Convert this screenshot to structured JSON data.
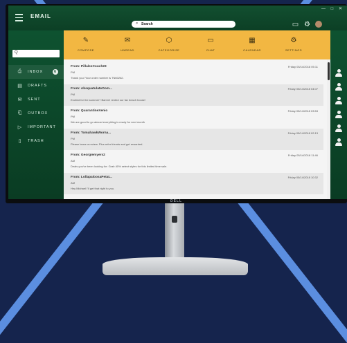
{
  "app": {
    "title": "EMAIL",
    "window_controls": "— □ ✕"
  },
  "search": {
    "text": "Search",
    "sidebar_placeholder": "Q"
  },
  "monitor": {
    "brand": "DELL"
  },
  "nav": [
    {
      "label": "INBOX",
      "icon": "inbox-icon",
      "glyph": "⎙",
      "badge": "6",
      "active": true
    },
    {
      "label": "DRAFTS",
      "icon": "drafts-icon",
      "glyph": "▤"
    },
    {
      "label": "SENT",
      "icon": "sent-icon",
      "glyph": "✉"
    },
    {
      "label": "OUTBOX",
      "icon": "outbox-icon",
      "glyph": "⎗"
    },
    {
      "label": "IMPORTANT",
      "icon": "important-icon",
      "glyph": "▷"
    },
    {
      "label": "TRASH",
      "icon": "trash-icon",
      "glyph": "▯"
    }
  ],
  "toolbar": [
    {
      "label": "COMPOSE",
      "icon": "pencil-icon",
      "glyph": "✎"
    },
    {
      "label": "UNREAD",
      "icon": "envelope-icon",
      "glyph": "✉"
    },
    {
      "label": "CATEGORIZE",
      "icon": "tag-icon",
      "glyph": "⬡"
    },
    {
      "label": "CHAT",
      "icon": "chat-icon",
      "glyph": "▭"
    },
    {
      "label": "CALENDAR",
      "icon": "calendar-icon",
      "glyph": "▦"
    },
    {
      "label": "SETTINGS",
      "icon": "gear-icon",
      "glyph": "⚙"
    }
  ],
  "messages": [
    {
      "from": "From: PillaleeCouch23",
      "date": "Friday 05/14/2018 05:11",
      "pm": "PM",
      "preview": "Thank you! Your order number is TN60262."
    },
    {
      "from": "From: AbsquatulateOom...",
      "date": "Friday 05/14/2018 04:07",
      "pm": "PM",
      "preview": "Excited for the summer? Bamm! rented our fav beach house!"
    },
    {
      "from": "From: QuarantineXenio",
      "date": "Friday 05/14/2018 03:53",
      "pm": "PM",
      "preview": "We are good to go almost everything is ready for next month"
    },
    {
      "from": "From: TomahawkWorna...",
      "date": "Friday 05/14/2018 02:13",
      "pm": "PM",
      "preview": "Please leave a review. Plus refer friends and get rewarded."
    },
    {
      "from": "From: Georgiemyers2",
      "date": "Friday 05/14/2018 11:46",
      "pm": "AM",
      "preview": "Deals you've been looking for: Grab 40% select styles for this limited time sale."
    },
    {
      "from": "From: LollapaloosaPetat...",
      "date": "Friday 05/14/2018 10:32",
      "pm": "AM",
      "preview": "Hey Michael I'll get that right to you."
    }
  ],
  "contacts_count": 6
}
